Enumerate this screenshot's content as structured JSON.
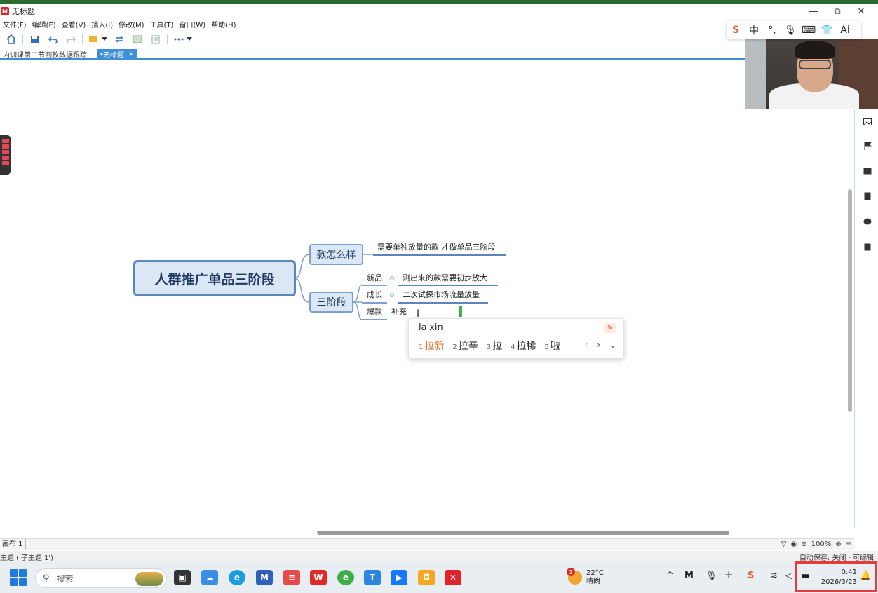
{
  "window": {
    "title": "无标题",
    "app_logo": "M",
    "controls": {
      "minimize": "—",
      "restore": "⧉",
      "close": "✕"
    }
  },
  "menu": [
    "文件(F)",
    "编辑(E)",
    "查看(V)",
    "插入(I)",
    "修改(M)",
    "工具(T)",
    "窗口(W)",
    "帮助(H)"
  ],
  "tabs": [
    {
      "label": "内训课第二节测款数据跟踪",
      "active": false
    },
    {
      "label": "*无标题",
      "active": true,
      "close": "×"
    }
  ],
  "mindmap": {
    "central": "人群推广单品三阶段",
    "branches": [
      {
        "label": "款怎么样",
        "children": [
          {
            "text": "需要单独放量的款 才做单品三阶段"
          }
        ]
      },
      {
        "label": "三阶段",
        "children": [
          {
            "label": "新品",
            "text": "测出来的款需要初步放大"
          },
          {
            "label": "成长",
            "text": "二次试探市场流量放量"
          },
          {
            "label": "爆款",
            "text": "补充"
          }
        ]
      }
    ]
  },
  "ime": {
    "pinyin": "la'xin",
    "candidates": [
      {
        "num": "1",
        "word": "拉新"
      },
      {
        "num": "2",
        "word": "拉辛"
      },
      {
        "num": "3",
        "word": "拉"
      },
      {
        "num": "4",
        "word": "拉稀"
      },
      {
        "num": "5",
        "word": "啦"
      }
    ],
    "nav": [
      "‹",
      "›",
      "⌄"
    ],
    "toolbar": [
      "S",
      "中",
      "°,",
      "🎙",
      "⌨",
      "👕",
      "Ai"
    ]
  },
  "bottom": {
    "sheet": "画布 1",
    "zoom": "100%",
    "status_left": "主题 ('子主题 1')",
    "status_right": "自动保存: 关闭  · 可编辑"
  },
  "taskbar": {
    "search_label": "搜索",
    "weather_temp": "22°C",
    "weather_desc": "晴朗",
    "weather_badge": "1",
    "time": "0:41",
    "date": "2026/3/23"
  },
  "colors": {
    "accent": "#3e8fd8",
    "topic_fill": "#dbe7f5",
    "topic_border": "#5a86c0",
    "ime_selected": "#e06a1a",
    "highlight_box": "#e83a3a"
  }
}
